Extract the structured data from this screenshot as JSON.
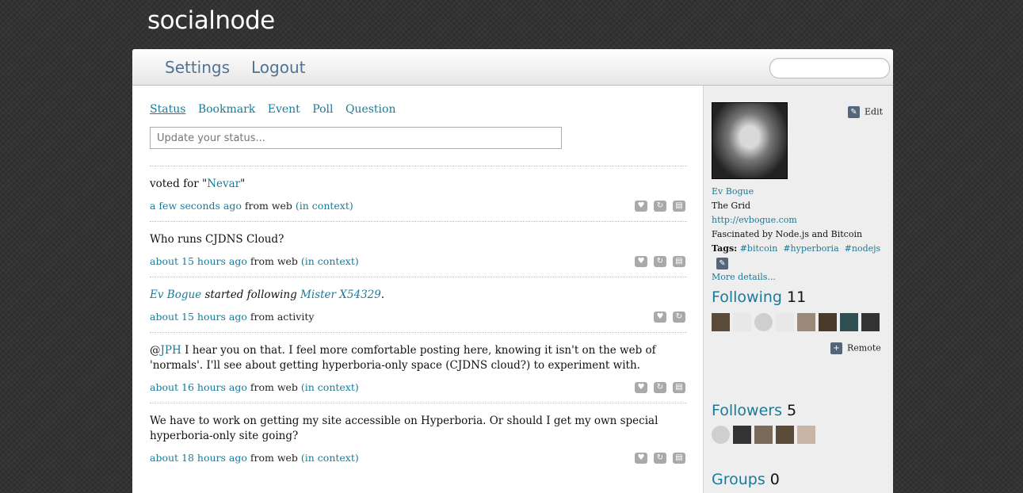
{
  "app": {
    "brand": "socialnode"
  },
  "topnav": {
    "settings_label": "Settings",
    "logout_label": "Logout",
    "search_placeholder": ""
  },
  "composer": {
    "tabs": [
      "Status",
      "Bookmark",
      "Event",
      "Poll",
      "Question"
    ],
    "active_tab": "Status",
    "placeholder": "Update your status..."
  },
  "feed": [
    {
      "pre": "voted for \"",
      "link": "Nevar",
      "post": "\"",
      "time": "a few seconds ago",
      "source": " from web ",
      "context": "(in context)"
    },
    {
      "text": "Who runs CJDNS Cloud?",
      "time": "about 15 hours ago",
      "source": " from web ",
      "context": "(in context)"
    },
    {
      "actor": "Ev Bogue",
      "verb": " started following ",
      "target": "Mister X54329",
      "end": ".",
      "time": "about 15 hours ago",
      "source": " from activity"
    },
    {
      "pre": "@",
      "link": "JPH",
      "post": " I hear you on that. I feel more comfortable posting here, knowing it isn't on the web of 'normals'. I'll see about getting hyperboria-only space (CJDNS cloud?) to experiment with.",
      "time": "about 16 hours ago",
      "source": " from web ",
      "context": "(in context)"
    },
    {
      "text": "We have to work on getting my site accessible on Hyperboria. Or should I get my own special hyperboria-only site going?",
      "time": "about 18 hours ago",
      "source": " from web ",
      "context": "(in context)"
    }
  ],
  "icons": {
    "like": "heart-icon",
    "repeat": "repeat-icon",
    "delete": "trash-icon",
    "edit": "pencil-icon",
    "add": "plus-icon"
  },
  "profile": {
    "edit_label": "Edit",
    "name": "Ev Bogue",
    "location": "The Grid",
    "url": "http://evbogue.com",
    "bio": "Fascinated by Node.js and Bitcoin",
    "tags_label": "Tags:",
    "tags": [
      "#bitcoin",
      "#hyperboria",
      "#nodejs"
    ],
    "more": "More details..."
  },
  "following": {
    "title": "Following",
    "count": "11"
  },
  "remote": {
    "label": "Remote"
  },
  "followers": {
    "title": "Followers",
    "count": "5"
  },
  "groups": {
    "title": "Groups",
    "count": "0"
  }
}
